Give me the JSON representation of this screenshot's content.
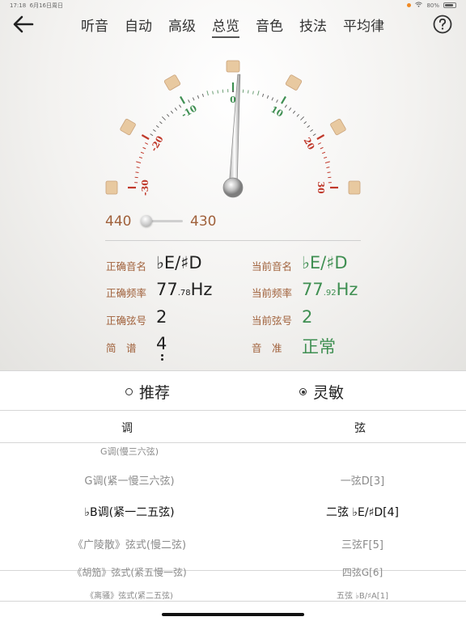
{
  "status_bar": {
    "time": "17:18",
    "date": "6月16日周日",
    "battery": "80%"
  },
  "nav": {
    "tabs": [
      {
        "label": "听音",
        "active": false
      },
      {
        "label": "自动",
        "active": false
      },
      {
        "label": "高级",
        "active": false
      },
      {
        "label": "总览",
        "active": true
      },
      {
        "label": "音色",
        "active": false
      },
      {
        "label": "技法",
        "active": false
      },
      {
        "label": "平均律",
        "active": false
      }
    ],
    "back_icon": "arrow-left-icon",
    "help_icon": "question-circle-icon"
  },
  "gauge": {
    "scale_labels": [
      "-30",
      "-20",
      "-10",
      "0",
      "10",
      "20",
      "30"
    ],
    "needle_cents": 1,
    "colors": {
      "negative": "#c0392b",
      "center": "#3f8f52",
      "positive": "#c0392b",
      "marker": "#e8c9a0"
    }
  },
  "reference": {
    "left": "440",
    "right": "430",
    "slider_value": 0
  },
  "info": {
    "correct_note_label": "正确音名",
    "correct_note_value": "♭E/♯D",
    "current_note_label": "当前音名",
    "current_note_value": "♭E/♯D",
    "correct_freq_label": "正确频率",
    "correct_freq_int": "77",
    "correct_freq_dec": ".78",
    "correct_freq_unit": "Hz",
    "current_freq_label": "当前频率",
    "current_freq_int": "77",
    "current_freq_dec": ".92",
    "current_freq_unit": "Hz",
    "correct_string_label": "正确弦号",
    "correct_string_value": "2",
    "current_string_label": "当前弦号",
    "current_string_value": "2",
    "jianpu_label": "简　谱",
    "jianpu_value": "4",
    "pitch_label": "音　准",
    "pitch_value": "正常"
  },
  "mode": {
    "options": [
      {
        "label": "推荐",
        "selected": false
      },
      {
        "label": "灵敏",
        "selected": true
      }
    ]
  },
  "table": {
    "key_header": "调",
    "string_header": "弦",
    "keys": [
      "G调(慢三六弦)",
      "G调(紧一慢三六弦)",
      "♭B调(紧一二五弦)",
      "《广陵散》弦式(慢二弦)",
      "《胡笳》弦式(紧五慢一弦)",
      "《离骚》弦式(紧二五弦)"
    ],
    "strings": [
      "",
      "一弦D[3]",
      "二弦 ♭E/♯D[4]",
      "三弦F[5]",
      "四弦G[6]",
      "五弦 ♭B/♯A[1]"
    ]
  }
}
